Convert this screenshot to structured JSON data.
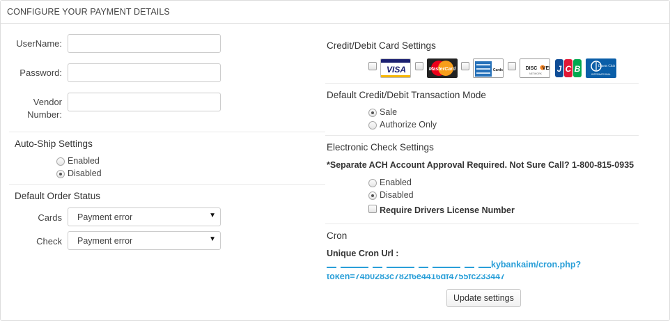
{
  "panel": {
    "title": "CONFIGURE YOUR PAYMENT DETAILS"
  },
  "credentials": {
    "username_label": "UserName:",
    "password_label": "Password:",
    "vendor_label_line1": "Vendor",
    "vendor_label_line2": "Number:",
    "username_value": "",
    "password_value": "",
    "vendor_value": ""
  },
  "autoship": {
    "title": "Auto-Ship Settings",
    "options": [
      {
        "label": "Enabled",
        "checked": false
      },
      {
        "label": "Disabled",
        "checked": true
      }
    ]
  },
  "order_status": {
    "title": "Default Order Status",
    "cards_label": "Cards",
    "cards_value": "Payment error",
    "check_label": "Check",
    "check_value": "Payment error"
  },
  "card_settings": {
    "title": "Credit/Debit Card Settings",
    "cards": [
      {
        "name": "VISA",
        "icon": "visa-logo",
        "checked": false
      },
      {
        "name": "MasterCard",
        "icon": "mastercard-logo",
        "checked": false
      },
      {
        "name": "American Express",
        "icon": "amex-logo",
        "checked": false
      },
      {
        "name": "DISCOVER",
        "icon": "discover-logo",
        "checked": false
      },
      {
        "name": "JCB",
        "icon": "jcb-logo",
        "checked": false
      },
      {
        "name": "Diners Club",
        "icon": "diners-logo",
        "checked": false
      }
    ]
  },
  "transaction_mode": {
    "title": "Default Credit/Debit Transaction Mode",
    "options": [
      {
        "label": "Sale",
        "checked": true
      },
      {
        "label": "Authorize Only",
        "checked": false
      }
    ]
  },
  "echeck": {
    "title": "Electronic Check Settings",
    "notice": "*Separate ACH Account Approval Required. Not Sure Call? 1-800-815-0935",
    "options": [
      {
        "label": "Enabled",
        "checked": false
      },
      {
        "label": "Disabled",
        "checked": true
      }
    ],
    "require_license_label": "Require Drivers License Number",
    "require_license_checked": false
  },
  "cron": {
    "title": "Cron",
    "url_label": "Unique Cron Url :",
    "url_line1": "kybankaim/cron.php?",
    "url_line2": "token=74b0283c782f6e4416df4755fc233447"
  },
  "actions": {
    "update_label": "Update settings"
  },
  "colors": {
    "link": "#2a9fd8",
    "border": "#dcdcdc"
  }
}
